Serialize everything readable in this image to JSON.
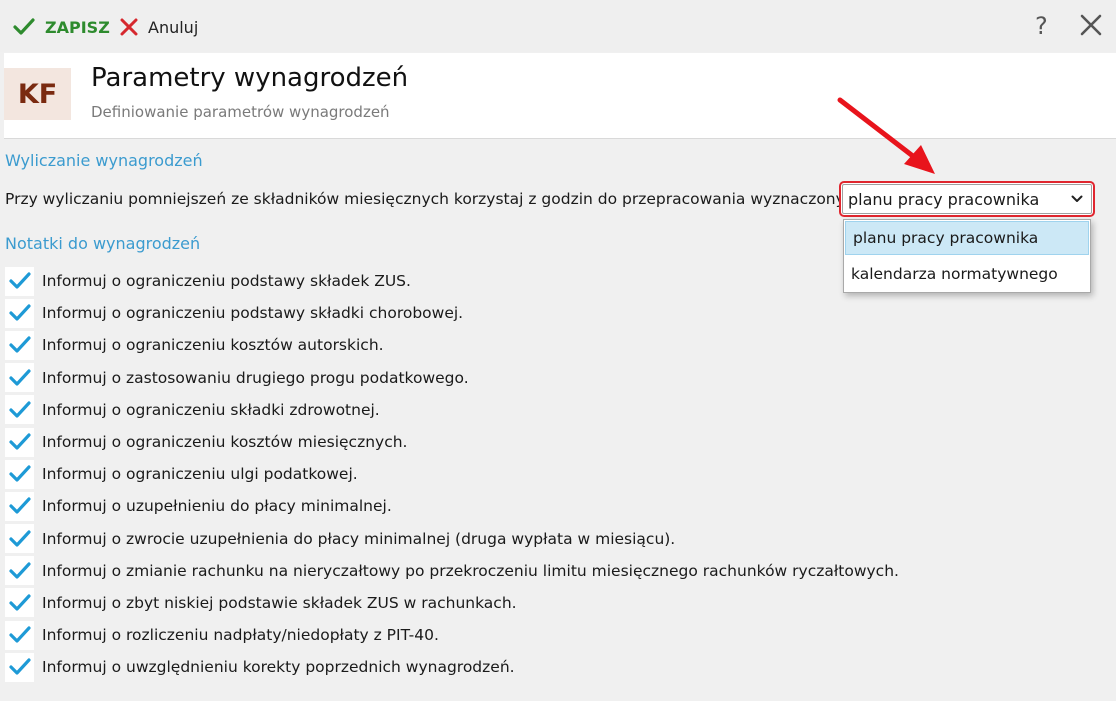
{
  "toolbar": {
    "save_label": "ZAPISZ",
    "cancel_label": "Anuluj",
    "help_label": "?"
  },
  "header": {
    "logo_text": "KF",
    "title": "Parametry wynagrodzeń",
    "subtitle": "Definiowanie parametrów wynagrodzeń"
  },
  "section_calc": {
    "title": "Wyliczanie wynagrodzeń",
    "prompt": "Przy wyliczaniu pomniejszeń ze składników miesięcznych korzystaj z godzin do przepracowania wyznaczonych z:"
  },
  "select": {
    "value": "planu pracy pracownika",
    "options": [
      "planu pracy pracownika",
      "kalendarza normatywnego"
    ]
  },
  "section_notes": {
    "title": "Notatki do wynagrodzeń",
    "items": [
      {
        "label": "Informuj o ograniczeniu podstawy składek ZUS.",
        "checked": true
      },
      {
        "label": "Informuj o ograniczeniu podstawy składki chorobowej.",
        "checked": true
      },
      {
        "label": "Informuj o ograniczeniu kosztów autorskich.",
        "checked": true
      },
      {
        "label": "Informuj o zastosowaniu drugiego progu podatkowego.",
        "checked": true
      },
      {
        "label": "Informuj o ograniczeniu składki zdrowotnej.",
        "checked": true
      },
      {
        "label": "Informuj o ograniczeniu kosztów miesięcznych.",
        "checked": true
      },
      {
        "label": "Informuj o ograniczeniu ulgi podatkowej.",
        "checked": true
      },
      {
        "label": "Informuj o uzupełnieniu do płacy minimalnej.",
        "checked": true
      },
      {
        "label": "Informuj o zwrocie uzupełnienia do płacy minimalnej (druga wypłata w miesiącu).",
        "checked": true
      },
      {
        "label": "Informuj o zmianie rachunku na nieryczałtowy po przekroczeniu limitu miesięcznego rachunków ryczałtowych.",
        "checked": true
      },
      {
        "label": "Informuj o zbyt niskiej podstawie składek ZUS w rachunkach.",
        "checked": true
      },
      {
        "label": "Informuj o rozliczeniu nadpłaty/niedopłaty z PIT-40.",
        "checked": true
      },
      {
        "label": "Informuj o uwzględnieniu korekty poprzednich wynagrodzeń.",
        "checked": true
      }
    ]
  },
  "colors": {
    "accent": "#3b9bcf",
    "check": "#1e9ad6",
    "highlight": "#e0262f",
    "save": "#2e8b2e"
  }
}
